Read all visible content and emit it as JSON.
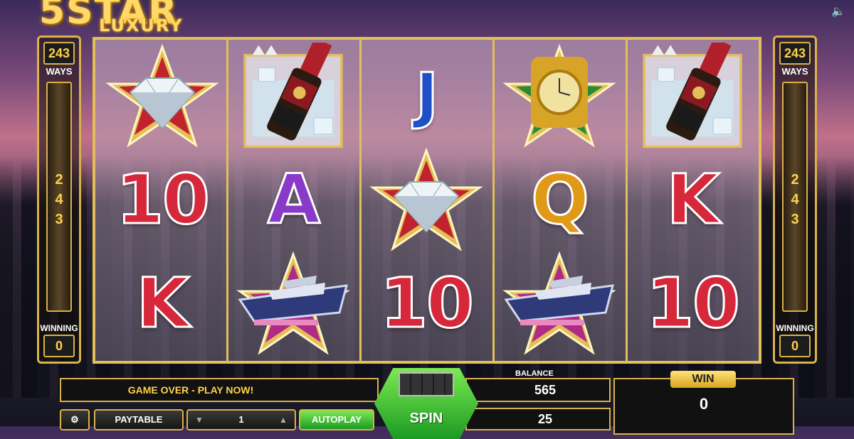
{
  "logo": {
    "line1": "5STAR",
    "line2": "LUXURY"
  },
  "sound_icon": "speaker-icon",
  "side_left": {
    "ways": "243",
    "ways_label": "WAYS",
    "digits": [
      "2",
      "4",
      "3"
    ],
    "winning_label": "WINNING",
    "winning_value": "0"
  },
  "side_right": {
    "ways": "243",
    "ways_label": "WAYS",
    "digits": [
      "2",
      "4",
      "3"
    ],
    "winning_label": "WINNING",
    "winning_value": "0"
  },
  "reels": {
    "rows": [
      [
        "diamond-star",
        "champagne",
        "J",
        "watch-star",
        "champagne"
      ],
      [
        "10",
        "A",
        "diamond-star",
        "Q",
        "K"
      ],
      [
        "K",
        "yacht-star",
        "10",
        "yacht-star",
        "10"
      ]
    ]
  },
  "message": "GAME OVER - PLAY NOW!",
  "balance": {
    "label": "BALANCE",
    "value": "565"
  },
  "bet": {
    "value": "25"
  },
  "win": {
    "label": "WIN",
    "value": "0"
  },
  "buttons": {
    "paytable": "PAYTABLE",
    "coin_value": "1",
    "autoplay": "AUTOPLAY",
    "spin": "SPIN"
  },
  "colors": {
    "gold": "#d9b24a",
    "green": "#3ec232",
    "red_symbol": "#d6283a"
  }
}
